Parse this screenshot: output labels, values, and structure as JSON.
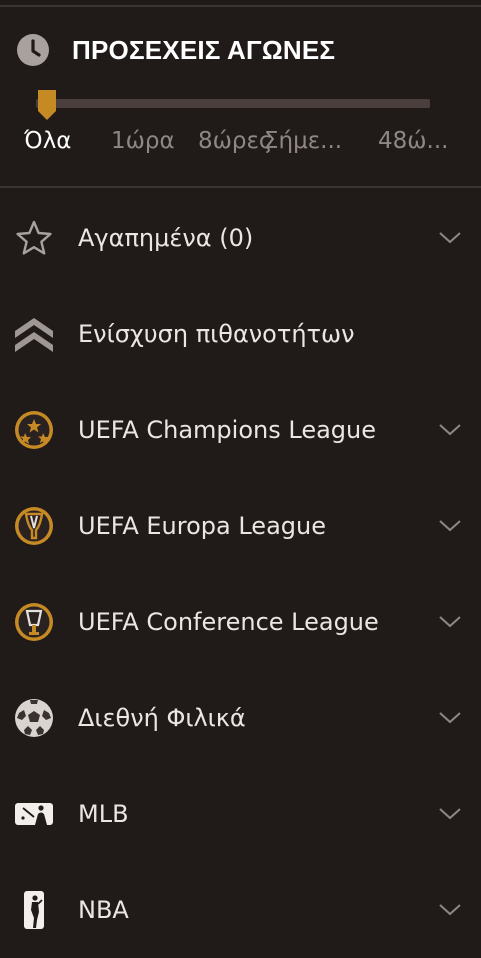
{
  "header": {
    "title": "ΠΡΟΣΕΧΕΙΣ ΑΓΩΝΕΣ",
    "icon": "clock-icon"
  },
  "time_filter": {
    "level": 0,
    "options": [
      {
        "label": "Όλα",
        "active": true
      },
      {
        "label": "1ώρα",
        "active": false
      },
      {
        "label": "8ώρες",
        "active": false
      },
      {
        "label": "Σήμε...",
        "active": false
      },
      {
        "label": "48ώ...",
        "active": false
      }
    ]
  },
  "menu": {
    "items": [
      {
        "label": "Αγαπημένα (0)",
        "icon": "star-icon",
        "expandable": true
      },
      {
        "label": "Ενίσχυση πιθανοτήτων",
        "icon": "chevrons-up-icon",
        "expandable": false
      },
      {
        "label": "UEFA Champions League",
        "icon": "champions-league-icon",
        "expandable": true
      },
      {
        "label": "UEFA Europa League",
        "icon": "europa-league-icon",
        "expandable": true
      },
      {
        "label": "UEFA Conference League",
        "icon": "conference-league-icon",
        "expandable": true
      },
      {
        "label": "Διεθνή Φιλικά",
        "icon": "soccer-ball-icon",
        "expandable": true
      },
      {
        "label": "MLB",
        "icon": "mlb-logo-icon",
        "expandable": true
      },
      {
        "label": "NBA",
        "icon": "nba-logo-icon",
        "expandable": true
      }
    ]
  },
  "colors": {
    "background": "#201a19",
    "accent": "#c68a25",
    "text": "#ebe6e2",
    "muted": "#8f8784"
  }
}
